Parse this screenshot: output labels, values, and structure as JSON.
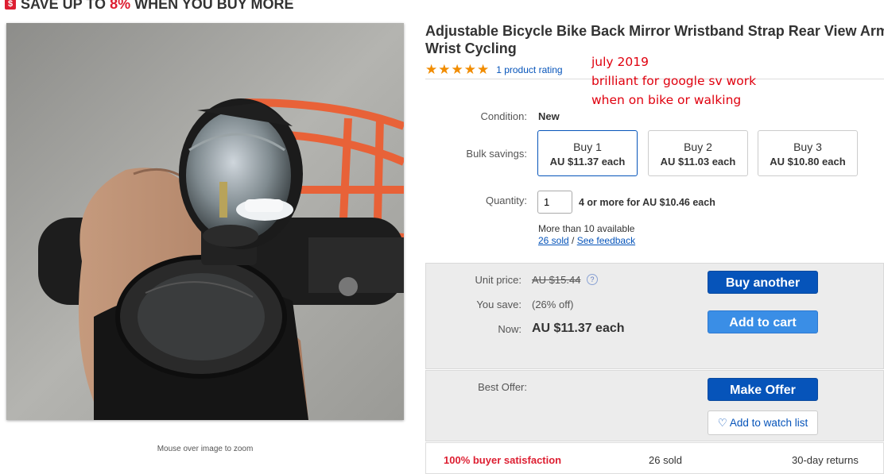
{
  "banner": {
    "text_pre": "SAVE UP TO ",
    "pct": "8%",
    "text_post": " WHEN YOU BUY MORE",
    "icon": "dollar-badge-icon"
  },
  "gallery": {
    "zoom_hint": "Mouse over image to zoom"
  },
  "product": {
    "title": "Adjustable Bicycle Bike Back Mirror Wristband Strap Rear View Arm Wrist Cycling",
    "stars": "★★★★★",
    "rating_link": "1 product rating"
  },
  "annotation": {
    "line1": "july 2019",
    "line2": "brilliant for google sv work",
    "line3": "when on bike or walking"
  },
  "details": {
    "condition_label": "Condition:",
    "condition_value": "New",
    "bulk_label": "Bulk savings:",
    "bulk_options": [
      {
        "qty": "Buy 1",
        "price": "AU $11.37 each"
      },
      {
        "qty": "Buy 2",
        "price": "AU $11.03 each"
      },
      {
        "qty": "Buy 3",
        "price": "AU $10.80 each"
      }
    ],
    "quantity_label": "Quantity:",
    "quantity_value": "1",
    "quantity_deal": "4 or more for AU $10.46 each",
    "available": "More than 10 available",
    "sold_link": "26 sold",
    "sep": " / ",
    "feedback_link": "See feedback"
  },
  "pricing": {
    "unit_label": "Unit price:",
    "unit_value": "AU $15.44",
    "save_label": "You save:",
    "save_value": "(26% off)",
    "now_label": "Now:",
    "now_value": "AU $11.37 each",
    "buy_another": "Buy another",
    "add_to_cart": "Add to cart"
  },
  "offer": {
    "label": "Best Offer:",
    "make_offer": "Make Offer",
    "watch": "Add to watch list"
  },
  "bottom_strip": {
    "satisfaction": "100% buyer satisfaction",
    "sold": "26 sold",
    "returns": "30-day returns"
  },
  "colors": {
    "accent_red": "#dd1e31",
    "link_blue": "#0654ba",
    "button_light": "#3a8ee6",
    "star": "#f18c00",
    "note_red": "#e0000e"
  }
}
